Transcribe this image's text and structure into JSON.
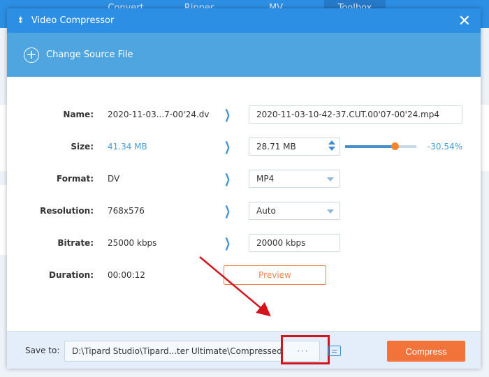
{
  "app": {
    "tabs": [
      "Convert",
      "Ripper",
      "MV",
      "Toolbox"
    ]
  },
  "dialog": {
    "title": "Video Compressor",
    "change_source": "Change Source File",
    "labels": {
      "name": "Name:",
      "size": "Size:",
      "format": "Format:",
      "resolution": "Resolution:",
      "bitrate": "Bitrate:",
      "duration": "Duration:"
    },
    "source": {
      "name": "2020-11-03...7-00'24.dv",
      "size": "41.34 MB",
      "format": "DV",
      "resolution": "768x576",
      "bitrate": "25000 kbps",
      "duration": "00:00:12"
    },
    "output": {
      "name": "2020-11-03-10-42-37.CUT.00'07-00'24.mp4",
      "size": "28.71 MB",
      "format": "MP4",
      "resolution": "Auto",
      "bitrate": "20000 kbps"
    },
    "compression_percent": "-30.54%",
    "slider_value_percent": 69.46,
    "preview_label": "Preview",
    "save_to_label": "Save to:",
    "save_path": "D:\\Tipard Studio\\Tipard...ter Ultimate\\Compressed",
    "browse_label": "···",
    "compress_label": "Compress"
  },
  "colors": {
    "primary": "#2d8fe3",
    "accent": "#f2743a",
    "highlight": "#d4141c"
  }
}
